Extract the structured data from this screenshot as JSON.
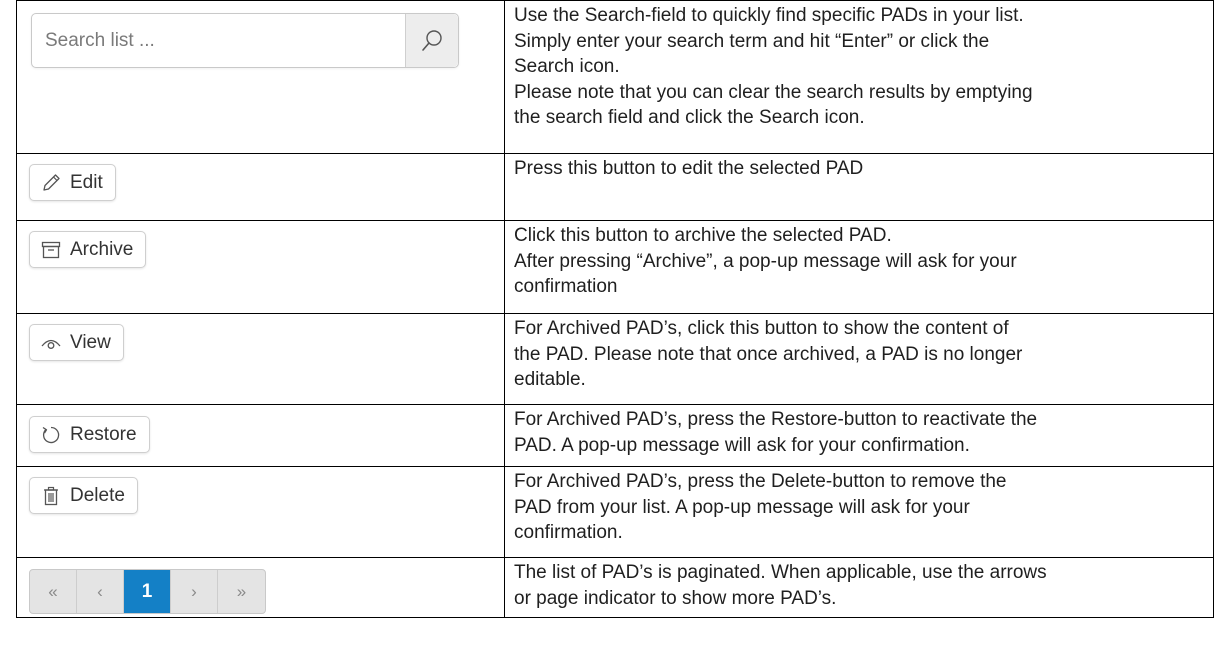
{
  "search": {
    "placeholder": "Search list ...",
    "icon": "search-icon",
    "description": [
      "Use the Search-field to quickly find specific PADs in your list.",
      "Simply enter your search term and hit “Enter” or click the",
      "Search icon.",
      "Please note that you can clear the search results by emptying",
      "the search field and click the Search icon."
    ]
  },
  "edit": {
    "label": "Edit",
    "icon": "pencil-icon",
    "description": [
      "Press this button to edit the selected PAD"
    ]
  },
  "archive": {
    "label": "Archive",
    "icon": "archive-box-icon",
    "description": [
      "Click this button to archive the selected PAD.",
      "After pressing “Archive”, a pop-up message will ask for your",
      "confirmation"
    ]
  },
  "view": {
    "label": "View",
    "icon": "eye-icon",
    "description": [
      "For Archived PAD’s, click this button to show the content of",
      "the PAD. Please note that once archived, a PAD is no longer",
      "editable."
    ]
  },
  "restore": {
    "label": "Restore",
    "icon": "restore-icon",
    "description": [
      "For Archived PAD’s, press the Restore-button to reactivate the",
      "PAD. A pop-up message will ask for your confirmation."
    ]
  },
  "delete": {
    "label": "Delete",
    "icon": "trash-icon",
    "description": [
      "For Archived PAD’s, press the Delete-button to remove the",
      "PAD from your list. A pop-up message will ask for your",
      "confirmation."
    ]
  },
  "pagination": {
    "first": "«",
    "prev": "‹",
    "current": "1",
    "next": "›",
    "last": "»",
    "active_color": "#1480c6",
    "description": [
      "The list of PAD’s is paginated. When applicable, use the arrows",
      "or page indicator to show more PAD’s."
    ]
  }
}
